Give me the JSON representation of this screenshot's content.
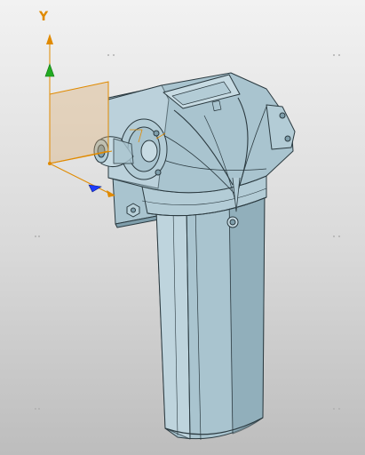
{
  "viewport": {
    "background_top": "#f2f2f2",
    "background_bottom": "#bdbdbd"
  },
  "triad": {
    "y_label": "Y",
    "colors": {
      "y_axis": "#e08a00",
      "x_axis": "#e08a00",
      "z_axis": "#e08a00",
      "y_handle": "#22aa22",
      "z_handle": "#1e3cff",
      "plane": "#d9a86a"
    }
  },
  "model": {
    "colors": {
      "body": "#a9c4cf",
      "body_light": "#c7dbe3",
      "body_dark": "#7f9eab",
      "edge": "#2b3a40"
    }
  }
}
